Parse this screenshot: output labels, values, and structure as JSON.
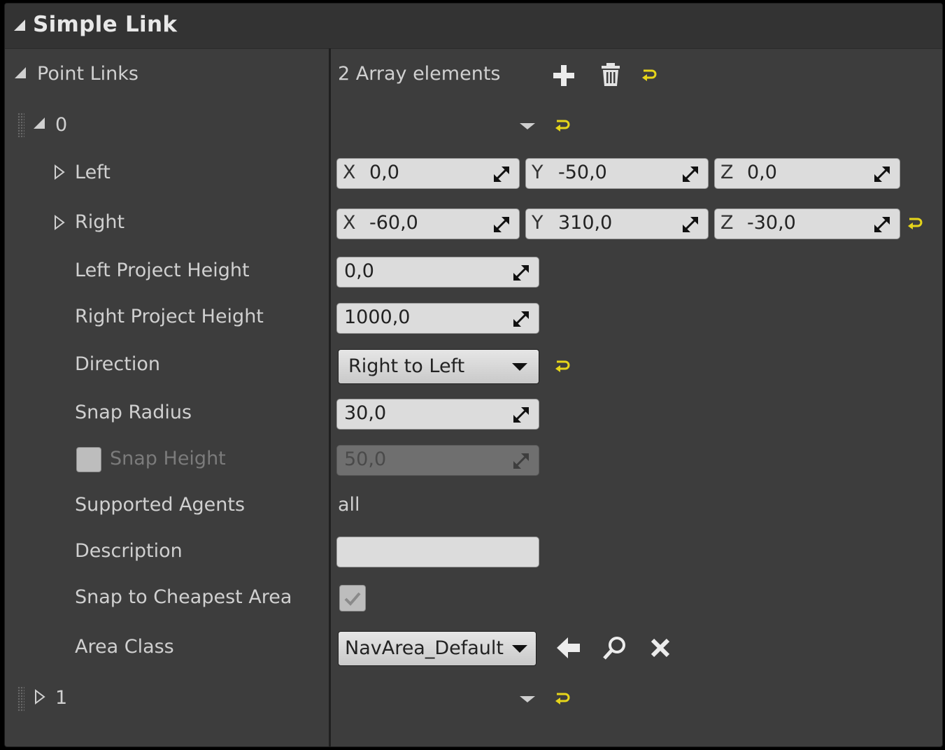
{
  "section": {
    "title": "Simple Link"
  },
  "point_links": {
    "label": "Point Links",
    "count_text": "2 Array elements"
  },
  "elements": [
    {
      "index": "0",
      "expanded": true
    },
    {
      "index": "1",
      "expanded": false
    }
  ],
  "props": {
    "left": {
      "label": "Left",
      "x_axis": "X",
      "x": "0,0",
      "y_axis": "Y",
      "y": "-50,0",
      "z_axis": "Z",
      "z": "0,0"
    },
    "right": {
      "label": "Right",
      "x_axis": "X",
      "x": "-60,0",
      "y_axis": "Y",
      "y": "310,0",
      "z_axis": "Z",
      "z": "-30,0"
    },
    "left_project_height": {
      "label": "Left Project Height",
      "value": "0,0"
    },
    "right_project_height": {
      "label": "Right Project Height",
      "value": "1000,0"
    },
    "direction": {
      "label": "Direction",
      "value": "Right to Left"
    },
    "snap_radius": {
      "label": "Snap Radius",
      "value": "30,0"
    },
    "snap_height": {
      "label": "Snap Height",
      "value": "50,0",
      "enabled": false
    },
    "supported_agents": {
      "label": "Supported Agents",
      "value": "all"
    },
    "description": {
      "label": "Description",
      "value": ""
    },
    "snap_to_cheapest_area": {
      "label": "Snap to Cheapest Area",
      "checked": true
    },
    "area_class": {
      "label": "Area Class",
      "value": "NavArea_Default"
    }
  },
  "icons": {
    "add": "plus-icon",
    "delete": "trash-icon",
    "reset": "reset-arrow-icon",
    "use_selected": "arrow-left-icon",
    "browse": "search-icon",
    "clear": "close-icon"
  },
  "colors": {
    "panel_bg": "#3d3d3d",
    "header_bg": "#333333",
    "reset_yellow": "#e6d51a",
    "field_bg": "#dcdcdc"
  }
}
